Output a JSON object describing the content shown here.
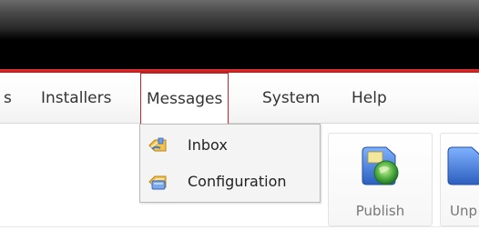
{
  "menubar": {
    "items": [
      {
        "label": "s"
      },
      {
        "label": "Installers"
      },
      {
        "label": "Messages"
      },
      {
        "label": "System"
      },
      {
        "label": "Help"
      }
    ],
    "active": "Messages"
  },
  "dropdown": {
    "items": [
      {
        "label": "Inbox",
        "icon": "inbox-icon"
      },
      {
        "label": "Configuration",
        "icon": "configuration-icon"
      }
    ]
  },
  "toolbar": {
    "buttons": [
      {
        "label": "Publish",
        "icon": "publish-icon"
      },
      {
        "label": "Unp",
        "icon": "unpublish-icon"
      }
    ]
  },
  "colors": {
    "accent_red": "#c8262b",
    "topbar": "#000000"
  }
}
